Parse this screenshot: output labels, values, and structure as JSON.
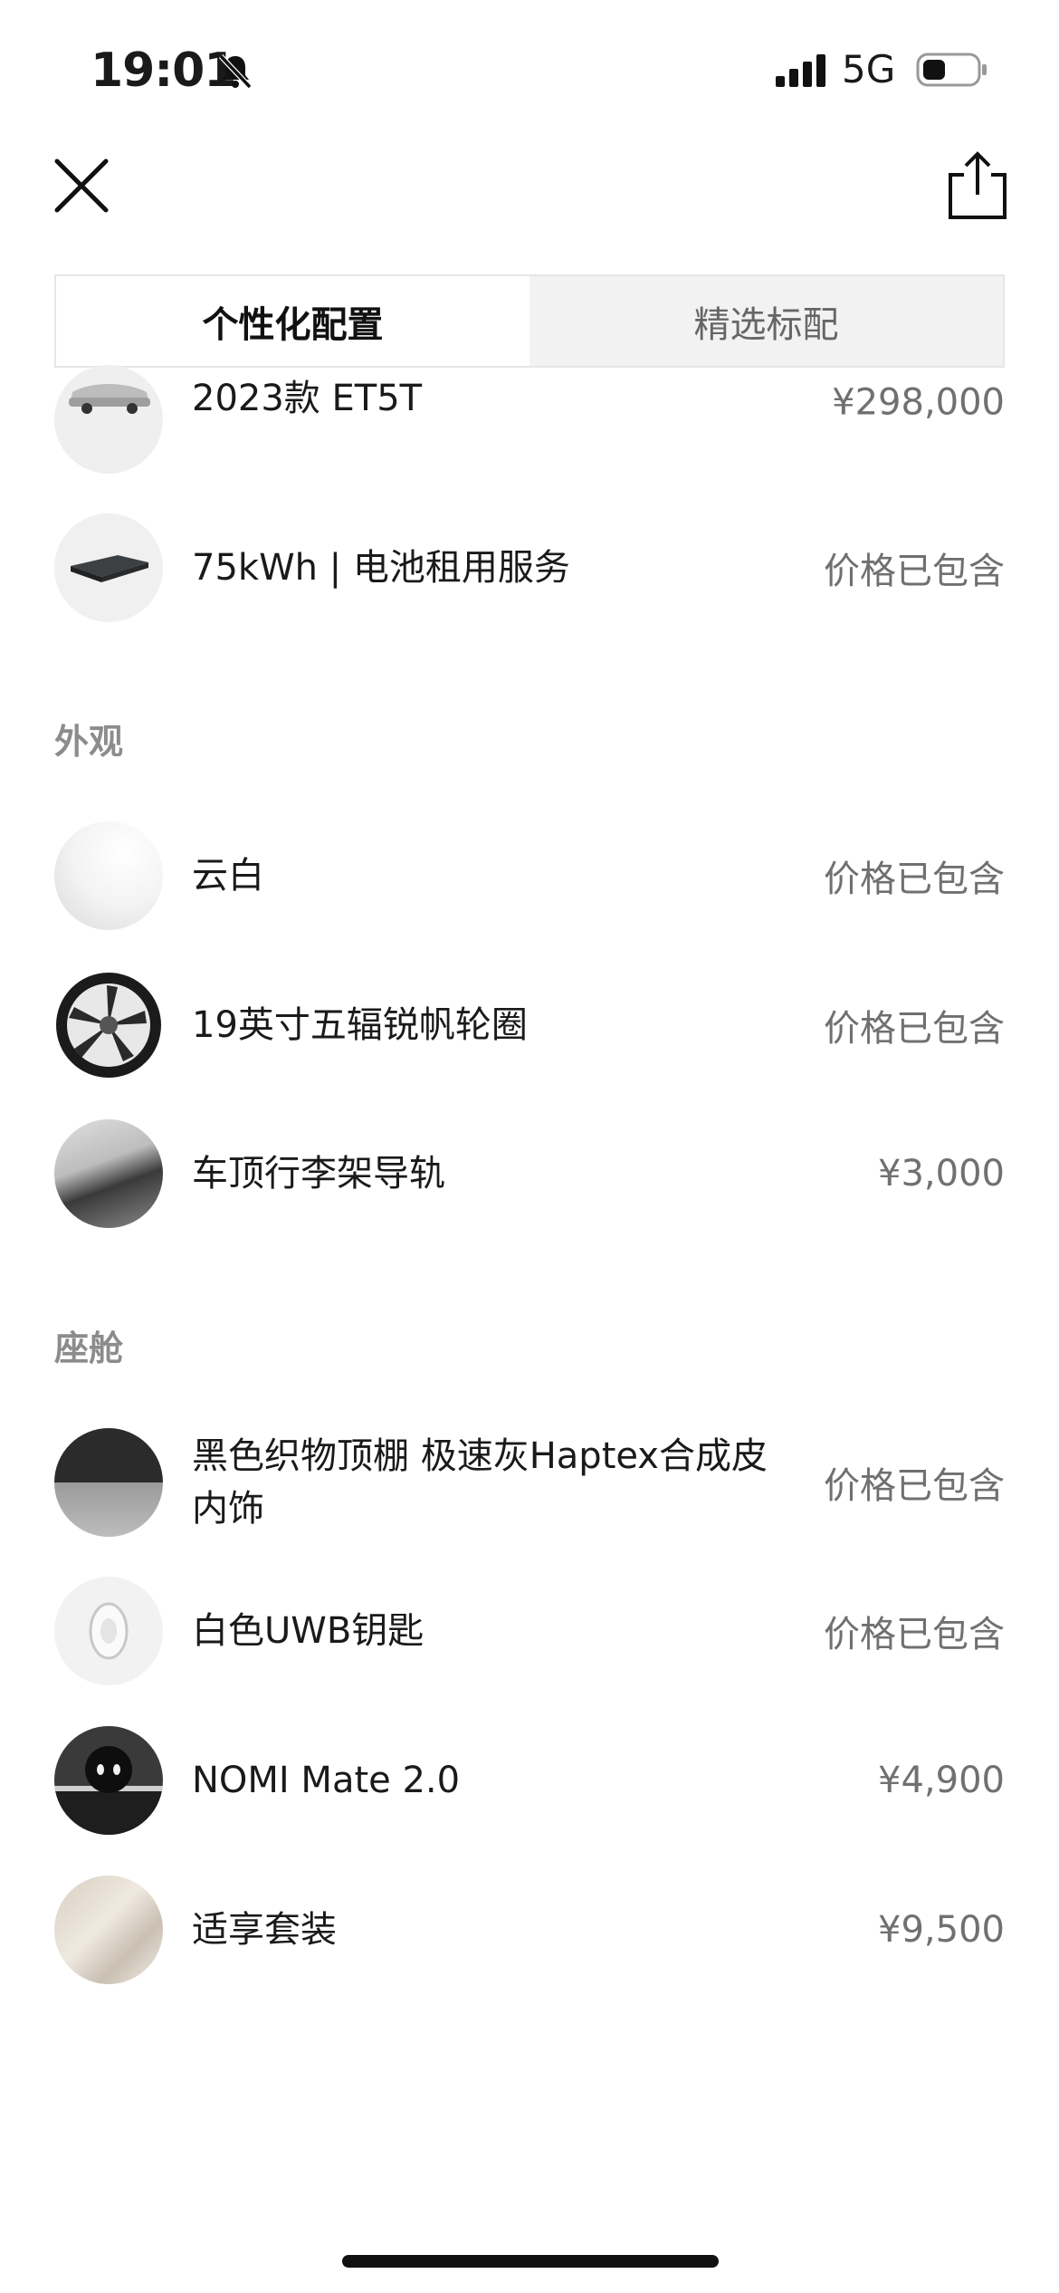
{
  "status_bar": {
    "time": "19:01",
    "network": "5G"
  },
  "tabs": [
    {
      "label": "个性化配置",
      "active": true
    },
    {
      "label": "精选标配",
      "active": false
    }
  ],
  "base_items": [
    {
      "label": "2023款 ET5T",
      "price": "¥298,000"
    },
    {
      "label": "75kWh | 电池租用服务",
      "price": "价格已包含"
    }
  ],
  "exterior": {
    "title": "外观",
    "items": [
      {
        "label": "云白",
        "price": "价格已包含"
      },
      {
        "label": "19英寸五辐锐帆轮圈",
        "price": "价格已包含"
      },
      {
        "label": "车顶行李架导轨",
        "price": "¥3,000"
      }
    ]
  },
  "cabin": {
    "title": "座舱",
    "items": [
      {
        "label": "黑色织物顶棚 极速灰Haptex合成皮内饰",
        "price": "价格已包含"
      },
      {
        "label": "白色UWB钥匙",
        "price": "价格已包含"
      },
      {
        "label": "NOMI Mate 2.0",
        "price": "¥4,900"
      },
      {
        "label": "适享套装",
        "price": "¥9,500"
      }
    ]
  }
}
